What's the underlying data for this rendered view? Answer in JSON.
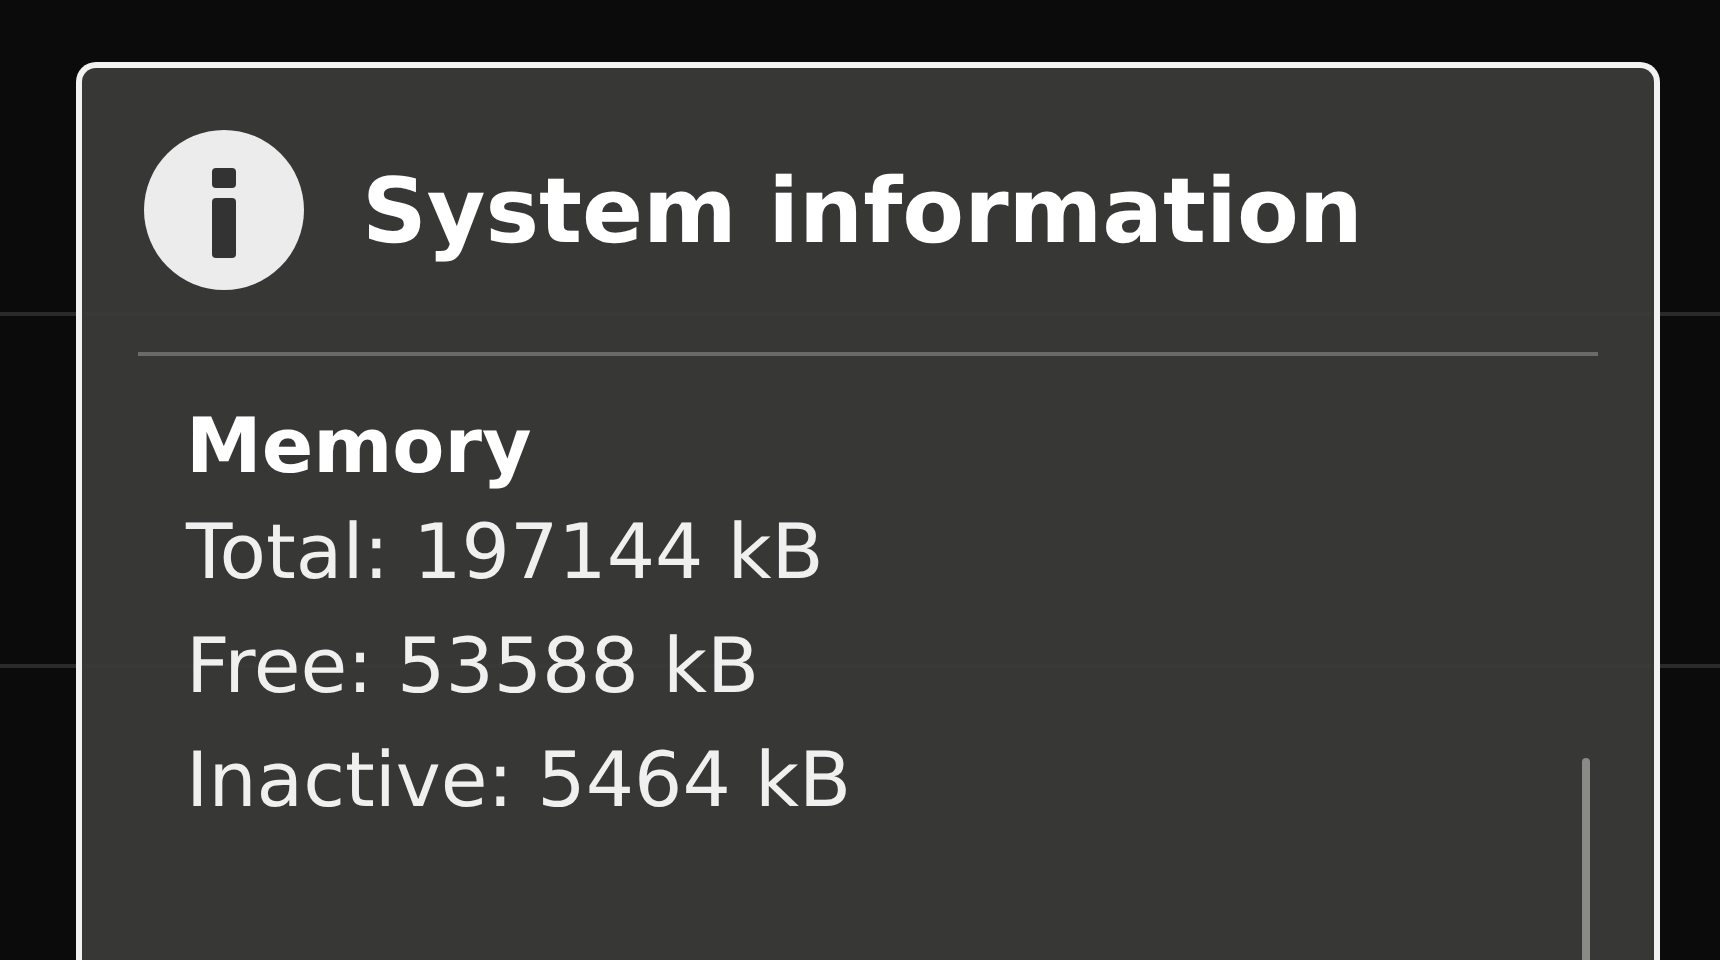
{
  "dialog": {
    "title": "System information",
    "section": "Memory",
    "lines": [
      "Total: 197144 kB",
      "Free: 53588 kB",
      "Inactive: 5464 kB"
    ]
  }
}
